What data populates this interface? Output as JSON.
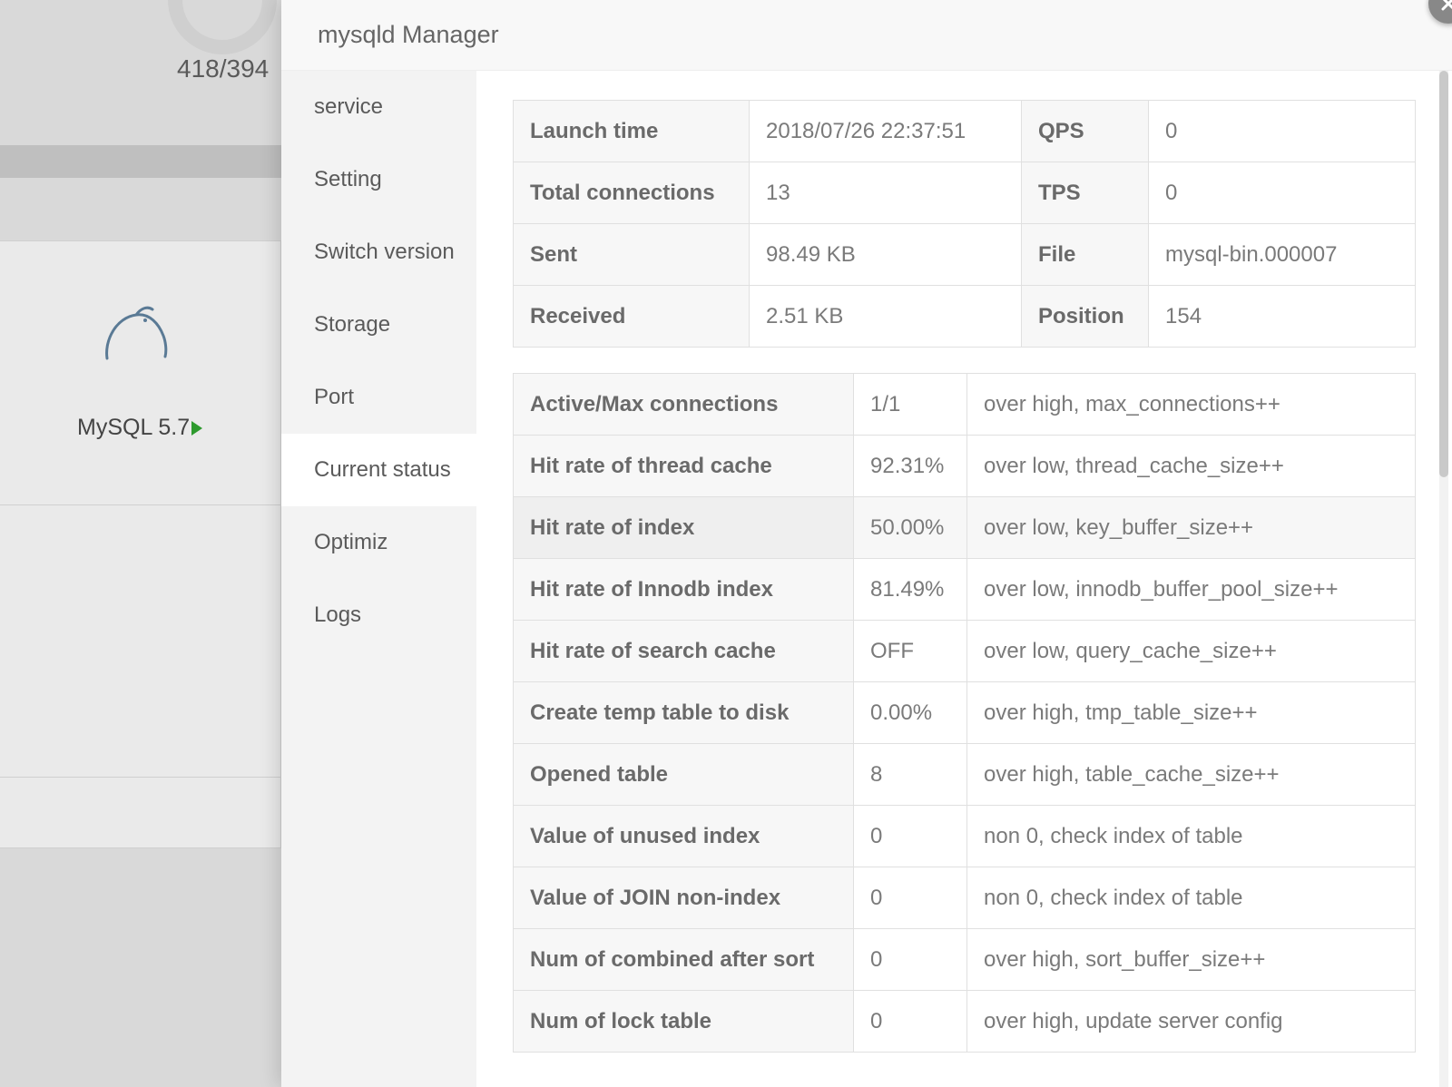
{
  "background": {
    "ratio": "418/394",
    "mysql_label": "MySQL 5.7"
  },
  "modal": {
    "title": "mysqld Manager",
    "sidebar": {
      "items": [
        {
          "label": "service"
        },
        {
          "label": "Setting"
        },
        {
          "label": "Switch version"
        },
        {
          "label": "Storage"
        },
        {
          "label": "Port"
        },
        {
          "label": "Current status"
        },
        {
          "label": "Optimiz"
        },
        {
          "label": "Logs"
        }
      ],
      "active_index": 5
    },
    "status": {
      "rows": [
        {
          "k1": "Launch time",
          "v1": "2018/07/26 22:37:51",
          "k2": "QPS",
          "v2": "0"
        },
        {
          "k1": "Total connections",
          "v1": "13",
          "k2": "TPS",
          "v2": "0"
        },
        {
          "k1": "Sent",
          "v1": "98.49 KB",
          "k2": "File",
          "v2": "mysql-bin.000007"
        },
        {
          "k1": "Received",
          "v1": "2.51 KB",
          "k2": "Position",
          "v2": "154"
        }
      ]
    },
    "metrics": {
      "rows": [
        {
          "name": "Active/Max connections",
          "value": "1/1",
          "hint": "over high, max_connections++"
        },
        {
          "name": "Hit rate of thread cache",
          "value": "92.31%",
          "hint": "over low, thread_cache_size++"
        },
        {
          "name": "Hit rate of index",
          "value": "50.00%",
          "hint": "over low, key_buffer_size++"
        },
        {
          "name": "Hit rate of Innodb index",
          "value": "81.49%",
          "hint": "over low, innodb_buffer_pool_size++"
        },
        {
          "name": "Hit rate of search cache",
          "value": "OFF",
          "hint": "over low, query_cache_size++"
        },
        {
          "name": "Create temp table to disk",
          "value": "0.00%",
          "hint": "over high, tmp_table_size++"
        },
        {
          "name": "Opened table",
          "value": "8",
          "hint": "over high, table_cache_size++"
        },
        {
          "name": "Value of unused index",
          "value": "0",
          "hint": "non 0, check index of table"
        },
        {
          "name": "Value of JOIN non-index",
          "value": "0",
          "hint": "non 0, check index of table"
        },
        {
          "name": "Num of combined after sort",
          "value": "0",
          "hint": "over high, sort_buffer_size++"
        },
        {
          "name": "Num of lock table",
          "value": "0",
          "hint": "over high, update server config"
        }
      ]
    }
  }
}
